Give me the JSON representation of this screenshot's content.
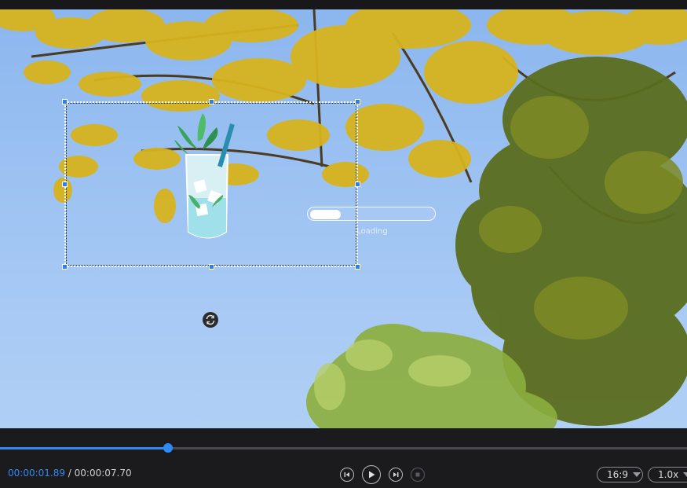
{
  "overlay": {
    "loading_text": "Loading",
    "loading_progress": 0.25
  },
  "player": {
    "current_time": "00:00:01.89",
    "separator": " / ",
    "total_time": "00:00:07.70",
    "progress": 0.245,
    "aspect_ratio": "16:9",
    "playback_speed": "1.0x"
  },
  "colors": {
    "accent": "#2f8af5",
    "handle": "#2f7fe6"
  },
  "icons": {
    "prev_frame": "step-back-icon",
    "play": "play-icon",
    "next_frame": "step-forward-icon",
    "stop": "stop-icon",
    "rotate": "rotate-icon"
  }
}
